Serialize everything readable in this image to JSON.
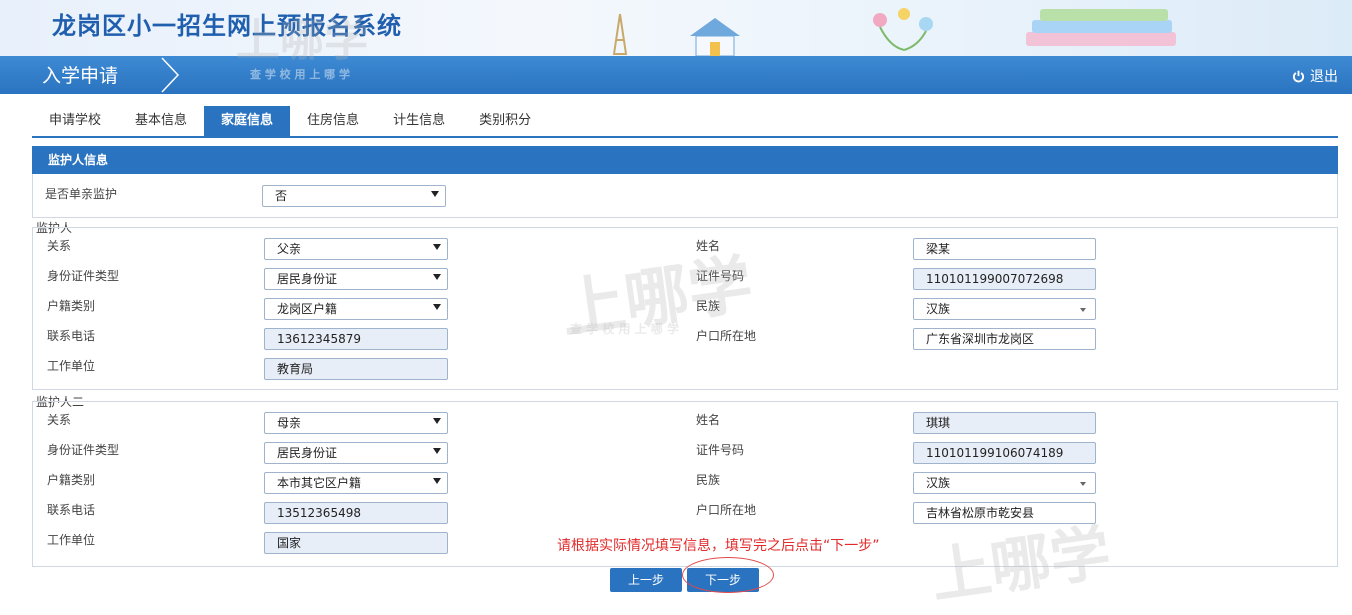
{
  "header": {
    "system_title": "龙岗区小一招生网上预报名系统"
  },
  "nav": {
    "section_title": "入学申请",
    "logout_label": "退出"
  },
  "tabs": [
    {
      "label": "申请学校",
      "active": false
    },
    {
      "label": "基本信息",
      "active": false
    },
    {
      "label": "家庭信息",
      "active": true
    },
    {
      "label": "住房信息",
      "active": false
    },
    {
      "label": "计生信息",
      "active": false
    },
    {
      "label": "类别积分",
      "active": false
    }
  ],
  "panel": {
    "title": "监护人信息",
    "single_parent_label": "是否单亲监护",
    "single_parent_value": "否"
  },
  "guardian1": {
    "legend": "监护人一",
    "relation_label": "关系",
    "relation_value": "父亲",
    "idtype_label": "身份证件类型",
    "idtype_value": "居民身份证",
    "hukou_label": "户籍类别",
    "hukou_value": "龙岗区户籍",
    "phone_label": "联系电话",
    "phone_value": "13612345879",
    "work_label": "工作单位",
    "work_value": "教育局",
    "name_label": "姓名",
    "name_value": "梁某",
    "idno_label": "证件号码",
    "idno_value": "110101199007072698",
    "ethnic_label": "民族",
    "ethnic_value": "汉族",
    "hukou_loc_label": "户口所在地",
    "hukou_loc_value": "广东省深圳市龙岗区"
  },
  "guardian2": {
    "legend": "监护人二",
    "relation_label": "关系",
    "relation_value": "母亲",
    "idtype_label": "身份证件类型",
    "idtype_value": "居民身份证",
    "hukou_label": "户籍类别",
    "hukou_value": "本市其它区户籍",
    "phone_label": "联系电话",
    "phone_value": "13512365498",
    "work_label": "工作单位",
    "work_value": "国家",
    "name_label": "姓名",
    "name_value": "琪琪",
    "idno_label": "证件号码",
    "idno_value": "110101199106074189",
    "ethnic_label": "民族",
    "ethnic_value": "汉族",
    "hukou_loc_label": "户口所在地",
    "hukou_loc_value": "吉林省松原市乾安县"
  },
  "hint": "请根据实际情况填写信息，填写完之后点击“下一步”",
  "buttons": {
    "prev_label": "上一步",
    "next_label": "下一步"
  },
  "watermark": {
    "big": "上哪学",
    "small": "查 学 校   用 上 哪 学"
  },
  "colors": {
    "primary": "#2a73c0",
    "title": "#1f5fae",
    "hint": "#e12a2a",
    "readonly_bg": "#e8eef8"
  },
  "icons": {
    "logout": "power-icon",
    "dropdown": "chevron-down-icon",
    "nav": "chevron-right-icon"
  }
}
